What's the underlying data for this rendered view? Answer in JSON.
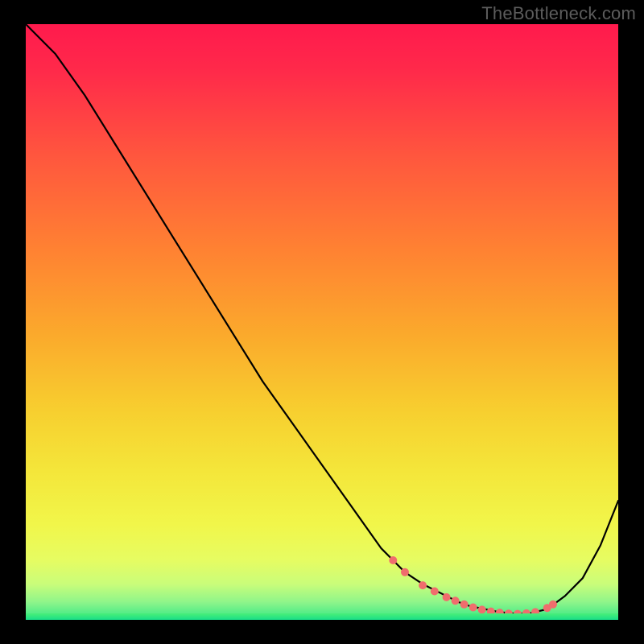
{
  "watermark": "TheBottleneck.com",
  "chart_data": {
    "type": "line",
    "title": "",
    "xlabel": "",
    "ylabel": "",
    "xlim": [
      0,
      100
    ],
    "ylim": [
      0,
      100
    ],
    "grid": false,
    "legend": false,
    "series": [
      {
        "name": "curve",
        "x": [
          0,
          5,
          10,
          15,
          20,
          25,
          30,
          35,
          40,
          45,
          50,
          55,
          60,
          62,
          64,
          67,
          70,
          73,
          75,
          78,
          80,
          82,
          83,
          85,
          88,
          91,
          94,
          97,
          100
        ],
        "y": [
          100,
          95,
          88,
          80,
          72,
          64,
          56,
          48,
          40,
          33,
          26,
          19,
          12,
          10,
          8,
          6,
          4.5,
          3,
          2.3,
          1.7,
          1.3,
          1.1,
          1.0,
          1.1,
          1.8,
          4,
          7,
          12.5,
          20
        ]
      }
    ],
    "markers": {
      "name": "valley-markers",
      "color": "#f06d6d",
      "radius_px": 5,
      "points": [
        {
          "x": 62,
          "y": 10.0
        },
        {
          "x": 64,
          "y": 8.0
        },
        {
          "x": 67,
          "y": 5.8
        },
        {
          "x": 69,
          "y": 4.8
        },
        {
          "x": 71,
          "y": 3.8
        },
        {
          "x": 72.5,
          "y": 3.2
        },
        {
          "x": 74,
          "y": 2.6
        },
        {
          "x": 75.5,
          "y": 2.1
        },
        {
          "x": 77,
          "y": 1.7
        },
        {
          "x": 78.5,
          "y": 1.4
        },
        {
          "x": 80,
          "y": 1.2
        },
        {
          "x": 81.5,
          "y": 1.05
        },
        {
          "x": 83,
          "y": 1.0
        },
        {
          "x": 84.5,
          "y": 1.1
        },
        {
          "x": 86,
          "y": 1.3
        },
        {
          "x": 88,
          "y": 2.0
        },
        {
          "x": 89,
          "y": 2.6
        }
      ]
    },
    "gradient_stops": [
      {
        "pos": 0.0,
        "color": "#ff1a4d"
      },
      {
        "pos": 0.5,
        "color": "#f9b82d"
      },
      {
        "pos": 0.85,
        "color": "#f1f64a"
      },
      {
        "pos": 1.0,
        "color": "#18dd88"
      }
    ]
  }
}
